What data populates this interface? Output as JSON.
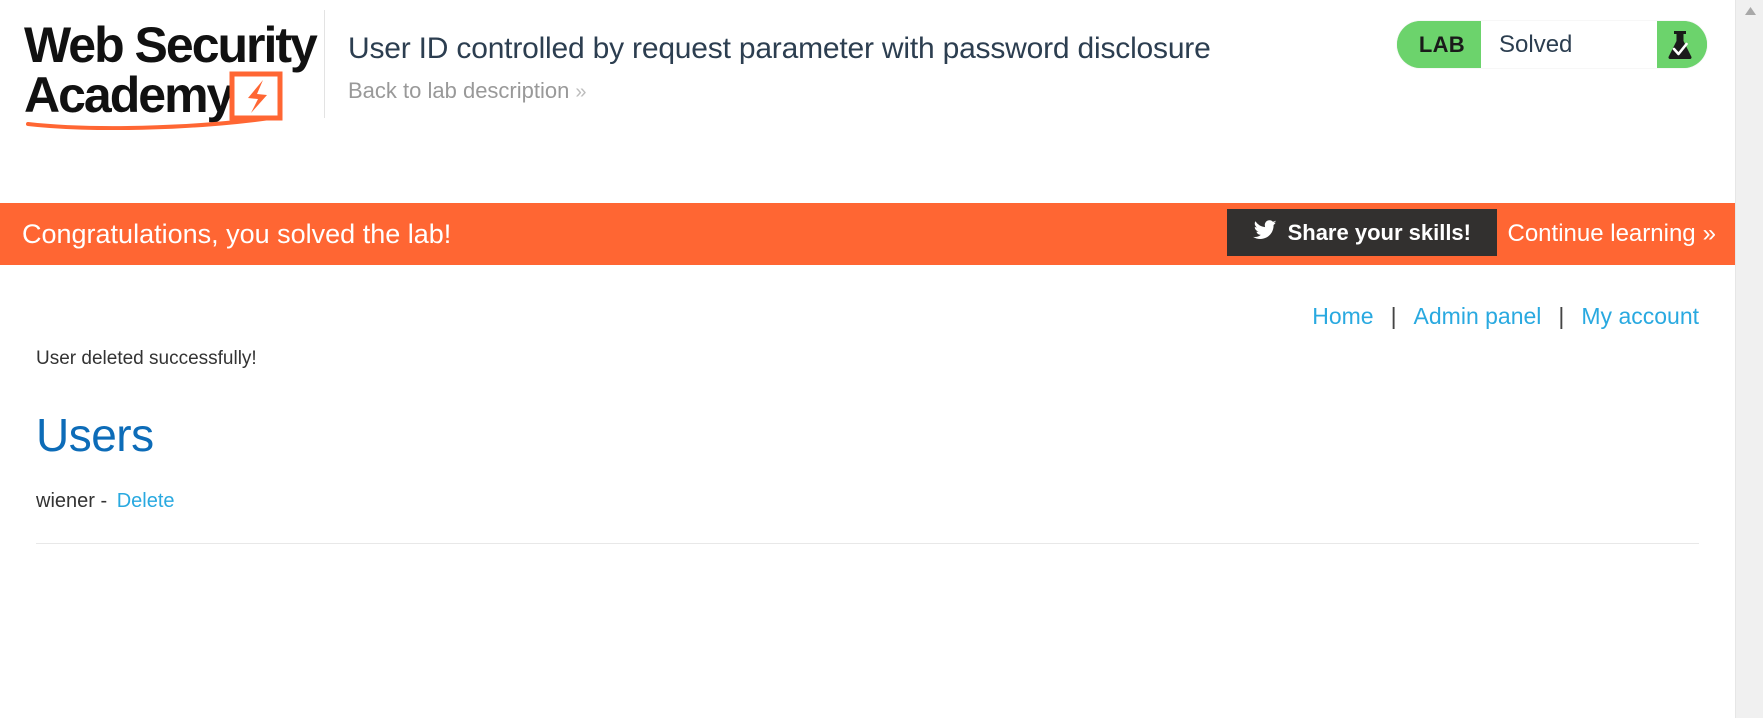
{
  "header": {
    "logo_line1": "Web Security",
    "logo_line2": "Academy",
    "lab_title": "User ID controlled by request parameter with password disclosure",
    "back_link": "Back to lab description",
    "back_link_chevron": "»",
    "lab_tag": "LAB",
    "lab_state": "Solved",
    "flask_icon": "flask-check-icon"
  },
  "banner": {
    "message": "Congratulations, you solved the lab!",
    "share_label": "Share your skills!",
    "share_icon": "twitter-bird-icon",
    "continue_label": "Continue learning",
    "continue_chevron": "»"
  },
  "nav": {
    "items": [
      {
        "label": "Home"
      },
      {
        "label": "Admin panel"
      },
      {
        "label": "My account"
      }
    ],
    "separator": "|"
  },
  "main": {
    "info_message": "User deleted successfully!",
    "heading": "Users",
    "users": [
      {
        "name": "wiener",
        "dash": "-",
        "action_label": "Delete"
      }
    ]
  },
  "colors": {
    "brand_orange": "#ff6633",
    "status_green": "#6cd36c",
    "link_blue": "#29a9e0",
    "heading_blue": "#0d6cb8",
    "dark_button": "#32302f",
    "text_dark": "#333333",
    "muted_gray": "#999999"
  },
  "scrollbar": {
    "up_arrow": "▲",
    "down_arrow": "▼"
  }
}
